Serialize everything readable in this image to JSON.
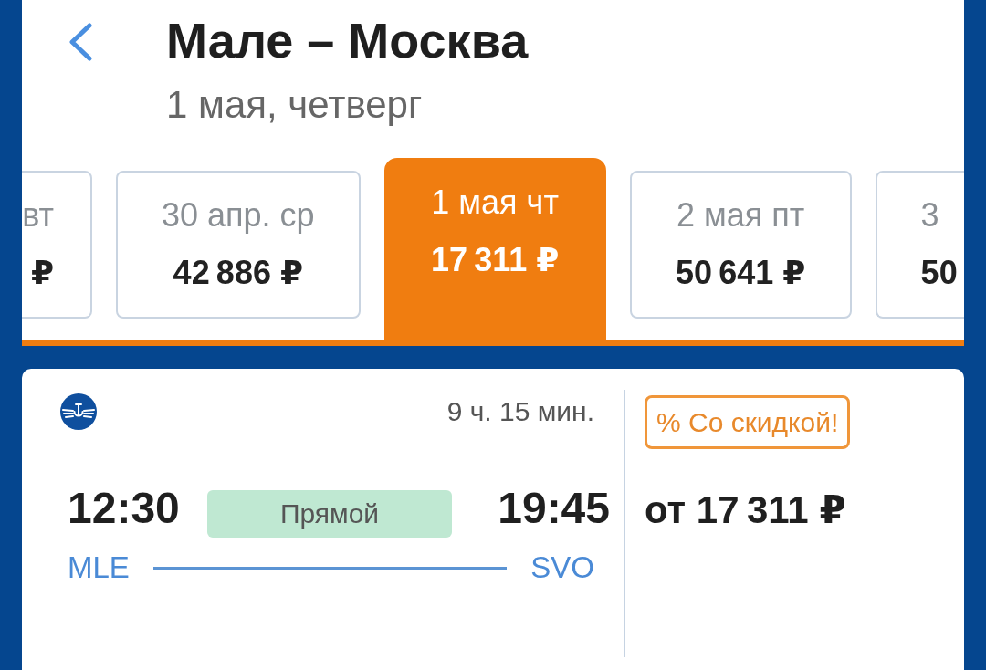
{
  "header": {
    "title": "Мале – Москва",
    "subtitle": "1 мая, четверг"
  },
  "date_strip": [
    {
      "label": "вт",
      "price": "₽",
      "selected": false
    },
    {
      "label": "30 апр. ср",
      "price": "42 886 ₽",
      "selected": false
    },
    {
      "label": "1 мая чт",
      "price": "17 311 ₽",
      "selected": true
    },
    {
      "label": "2 мая пт",
      "price": "50 641 ₽",
      "selected": false
    },
    {
      "label": "3",
      "price": "50",
      "selected": false
    }
  ],
  "flights": [
    {
      "duration": "9 ч. 15 мин.",
      "departure_time": "12:30",
      "stops": "Прямой",
      "arrival_time": "19:45",
      "origin": "MLE",
      "destination": "SVO",
      "badge": "% Со скидкой!",
      "price": "от 17 311 ₽"
    }
  ]
}
